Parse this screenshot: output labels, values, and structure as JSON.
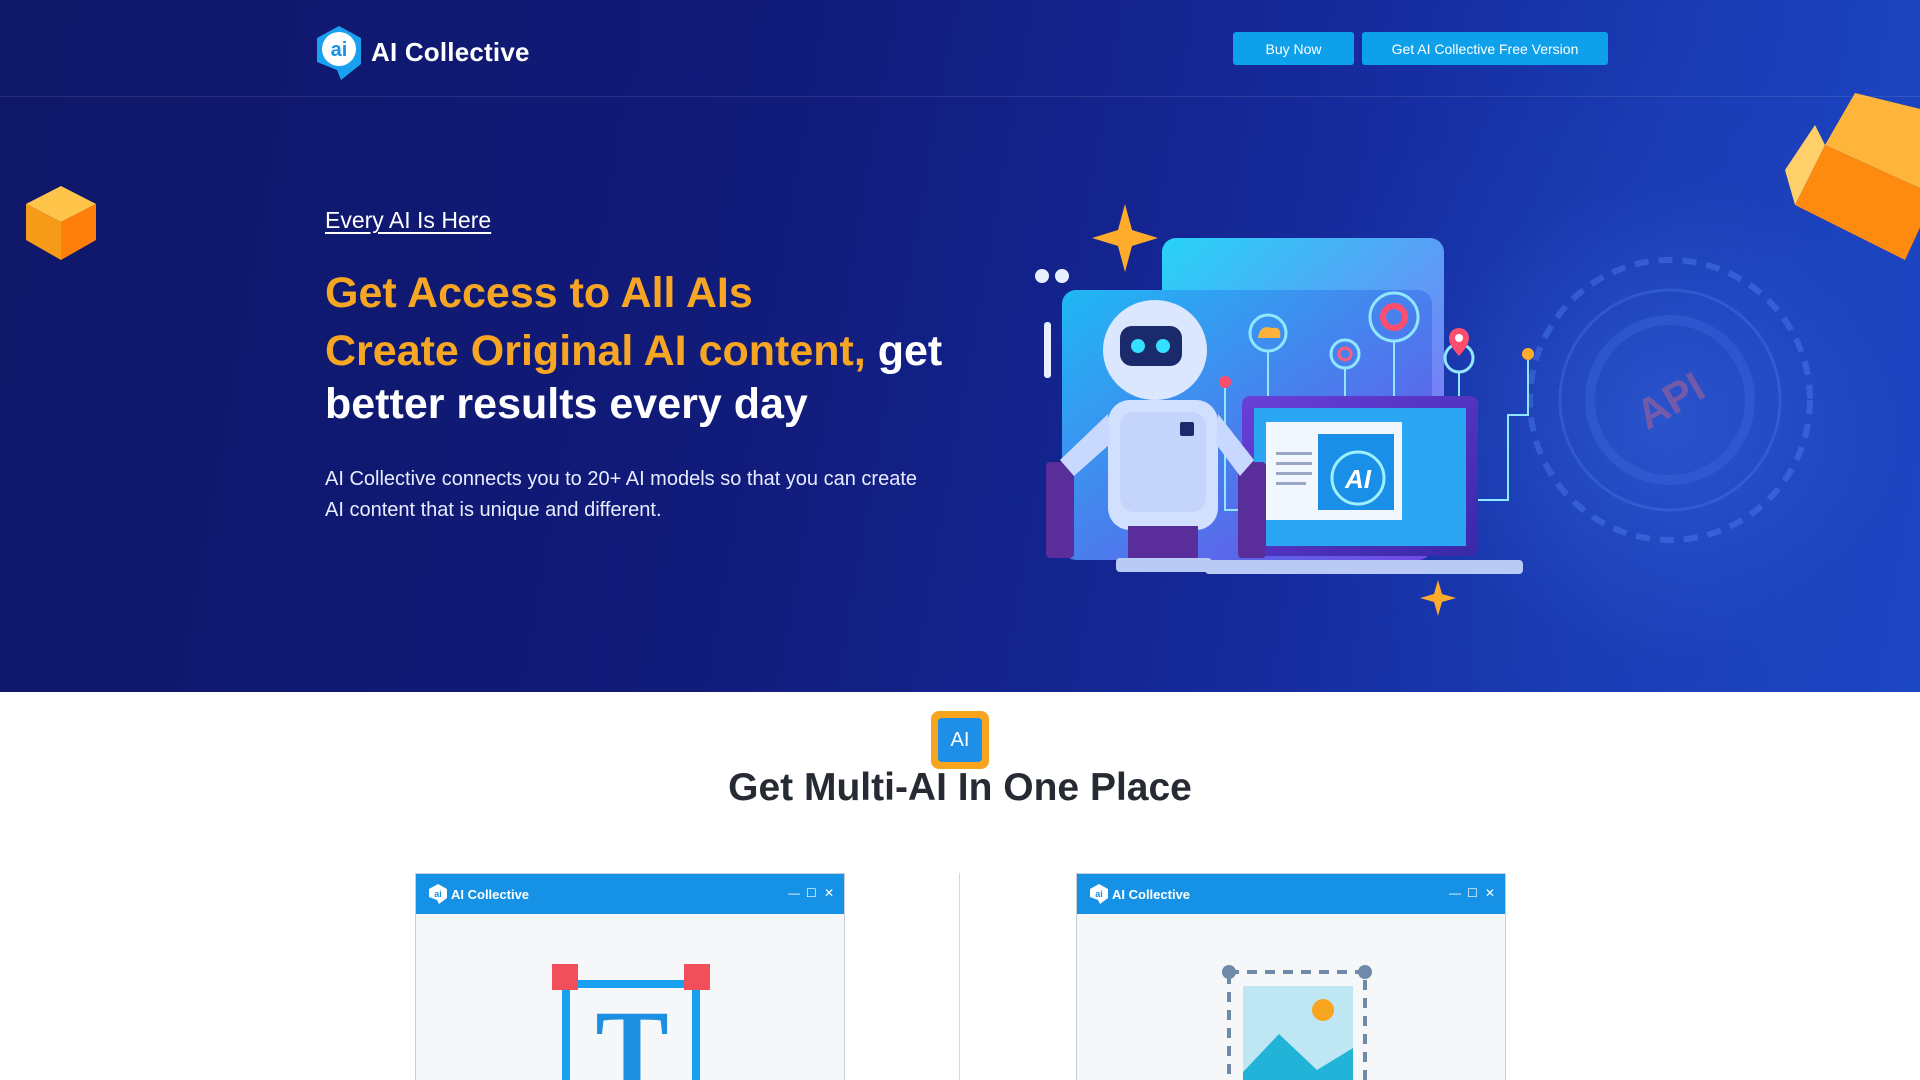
{
  "header": {
    "brand": "AI Collective",
    "logo_glyph": "ai",
    "buttons": {
      "buy_now": "Buy Now",
      "free_version": "Get AI Collective Free Version"
    }
  },
  "hero": {
    "tagline": "Every AI Is Here",
    "headline_line1": "Get Access to All AIs",
    "headline_line2_orange": "Create Original AI content,",
    "headline_line2_white": " get better results every day",
    "description": "AI Collective connects you to 20+ AI models so that you can create AI content that is unique and different.",
    "illustration_screen_label": "AI",
    "background_text": "API"
  },
  "section": {
    "badge_label": "AI",
    "title": "Get Multi-AI In One Place"
  },
  "windows": [
    {
      "title": "AI Collective",
      "logo_glyph": "ai",
      "icon": "text-icon",
      "icon_letter": "T"
    },
    {
      "title": "AI Collective",
      "logo_glyph": "ai",
      "icon": "image-icon"
    }
  ],
  "window_controls": {
    "minimize": "—",
    "maximize": "☐",
    "close": "✕"
  },
  "colors": {
    "hero_bg": "#111b7a",
    "accent_orange": "#f6a623",
    "button_blue": "#0fa0ec",
    "window_bar": "#1592e6",
    "title_dark": "#262a33"
  }
}
